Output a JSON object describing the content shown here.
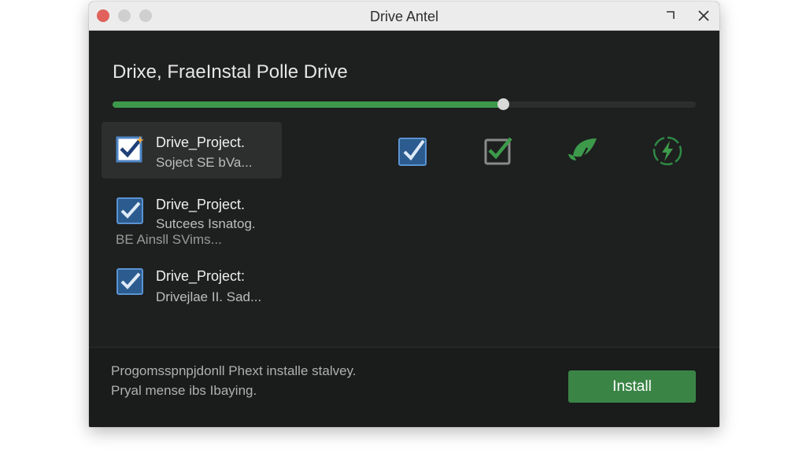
{
  "window": {
    "title": "Drive Antel"
  },
  "heading": "Drixe, FraeInstal Polle Drive",
  "progress": {
    "fraction": 0.67,
    "color": "#3d9a4c"
  },
  "items": [
    {
      "title": "Drive_Project.",
      "subtitle": "Soject SE bVa...",
      "checked": true,
      "selected": true
    },
    {
      "title": "Drive_Project.",
      "subtitle": "Sutcees Isnatog.",
      "extra": "BE Ainsll SVims...",
      "checked": true
    },
    {
      "title": "Drive_Project:",
      "subtitle": "Drivejlae II. Sad...",
      "checked": true
    }
  ],
  "icons": [
    "checkbox-icon",
    "check-square-icon",
    "leaf-icon",
    "bolt-icon"
  ],
  "footer": {
    "line1": "Progomsspnpjdonll Phext installe stalvey.",
    "line2": "Pryal mense ibs Ibaying."
  },
  "install_label": "Install",
  "colors": {
    "accent": "#3a8446",
    "checkbox": "#4d86c6"
  }
}
